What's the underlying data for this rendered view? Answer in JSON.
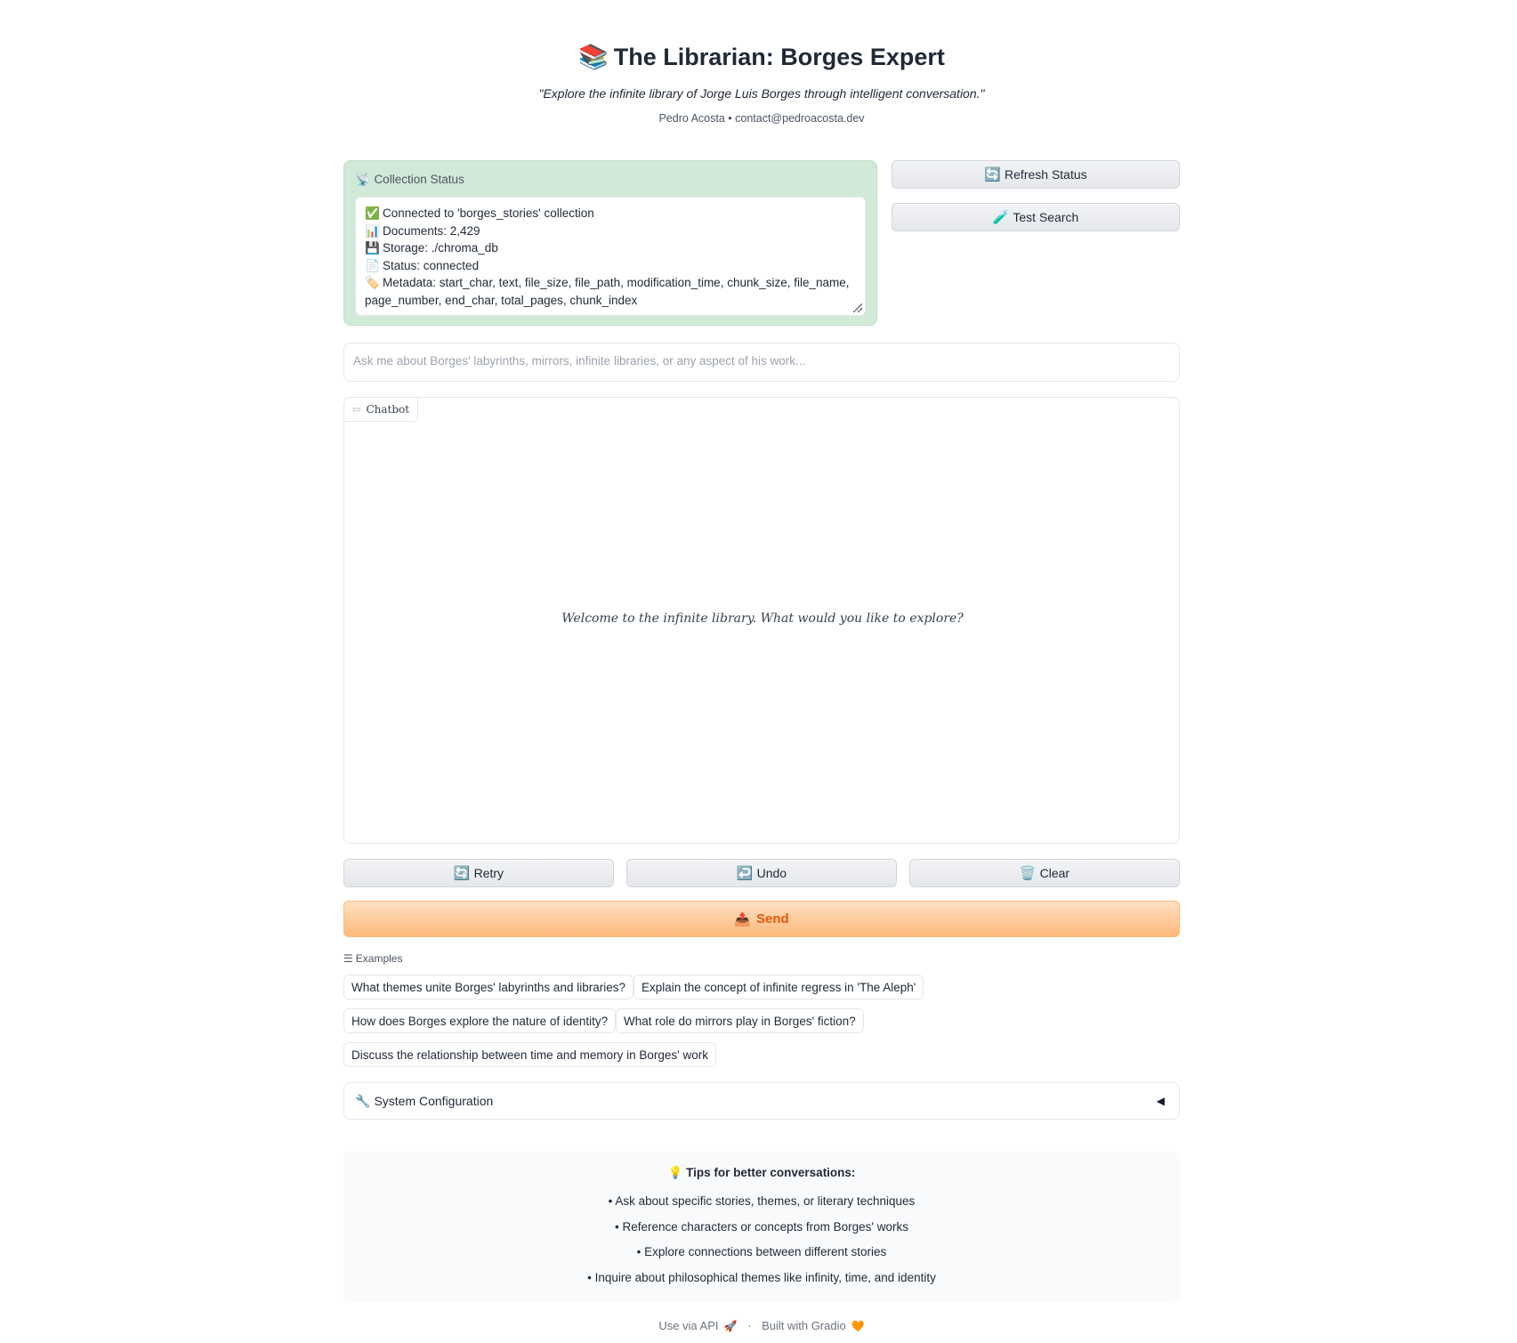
{
  "header": {
    "title_emoji": "📚",
    "title": "The Librarian: Borges Expert",
    "tagline": "\"Explore the infinite library of Jorge Luis Borges through intelligent conversation.\"",
    "byline": "Pedro Acosta • contact@pedroacosta.dev"
  },
  "collection_status": {
    "label_icon": "📡",
    "label": "Collection Status",
    "lines": [
      {
        "icon": "✅",
        "text": "Connected to 'borges_stories' collection"
      },
      {
        "icon": "📊",
        "text": "Documents: 2,429"
      },
      {
        "icon": "💾",
        "text": "Storage: ./chroma_db"
      },
      {
        "icon": "📄",
        "text": "Status: connected"
      },
      {
        "icon": "🏷️",
        "text": "Metadata: start_char, text, file_size, file_path, modification_time, chunk_size, file_name, page_number, end_char, total_pages, chunk_index"
      }
    ]
  },
  "side_buttons": {
    "refresh_icon": "🔄",
    "refresh": "Refresh Status",
    "test_icon": "🧪",
    "test": "Test Search"
  },
  "input": {
    "placeholder": "Ask me about Borges' labyrinths, mirrors, infinite libraries, or any aspect of his work..."
  },
  "chatbot": {
    "label": "Chatbot",
    "welcome": "Welcome to the infinite library. What would you like to explore?"
  },
  "actions": {
    "retry_icon": "🔄",
    "retry": "Retry",
    "undo_icon": "↩️",
    "undo": "Undo",
    "clear_icon": "🗑️",
    "clear": "Clear",
    "send_icon": "📤",
    "send": "Send"
  },
  "examples": {
    "label": "Examples",
    "items": [
      "What themes unite Borges' labyrinths and libraries?",
      "Explain the concept of infinite regress in 'The Aleph'",
      "How does Borges explore the nature of identity?",
      "What role do mirrors play in Borges' fiction?",
      "Discuss the relationship between time and memory in Borges' work"
    ]
  },
  "config": {
    "icon": "🔧",
    "label": "System Configuration"
  },
  "tips": {
    "icon": "💡",
    "title": "Tips for better conversations:",
    "items": [
      "• Ask about specific stories, themes, or literary techniques",
      "• Reference characters or concepts from Borges' works",
      "• Explore connections between different stories",
      "• Inquire about philosophical themes like infinity, time, and identity"
    ]
  },
  "footer": {
    "api": "Use via API",
    "api_icon": "🚀",
    "separator": "·",
    "built": "Built with Gradio",
    "built_icon": "🧡"
  },
  "colors": {
    "status_bg": "#d1ead8",
    "send_accent": "#ea580c",
    "send_bg": "#fdb77a"
  }
}
